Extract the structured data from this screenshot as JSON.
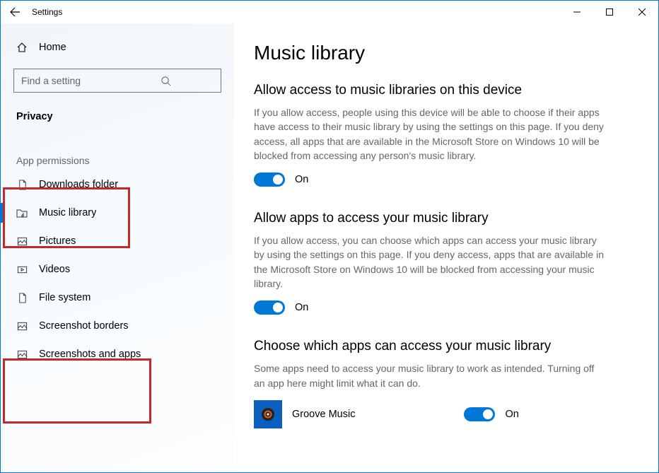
{
  "window": {
    "title": "Settings"
  },
  "sidebar": {
    "home": "Home",
    "search_placeholder": "Find a setting",
    "category": "Privacy",
    "section_header": "App permissions",
    "items": [
      {
        "label": "Downloads folder"
      },
      {
        "label": "Music library"
      },
      {
        "label": "Pictures"
      },
      {
        "label": "Videos"
      },
      {
        "label": "File system"
      },
      {
        "label": "Screenshot borders"
      },
      {
        "label": "Screenshots and apps"
      }
    ]
  },
  "main": {
    "title": "Music library",
    "section1": {
      "title": "Allow access to music libraries on this device",
      "desc": "If you allow access, people using this device will be able to choose if their apps have access to their music library by using the settings on this page. If you deny access, all apps that are available in the Microsoft Store on Windows 10 will be blocked from accessing any person's music library.",
      "toggle": "On"
    },
    "section2": {
      "title": "Allow apps to access your music library",
      "desc": "If you allow access, you can choose which apps can access your music library by using the settings on this page. If you deny access, apps that are available in the Microsoft Store on Windows 10 will be blocked from accessing your music library.",
      "toggle": "On"
    },
    "section3": {
      "title": "Choose which apps can access your music library",
      "desc": "Some apps need to access your music library to work as intended. Turning off an app here might limit what it can do.",
      "apps": [
        {
          "name": "Groove Music",
          "toggle": "On"
        }
      ]
    }
  }
}
